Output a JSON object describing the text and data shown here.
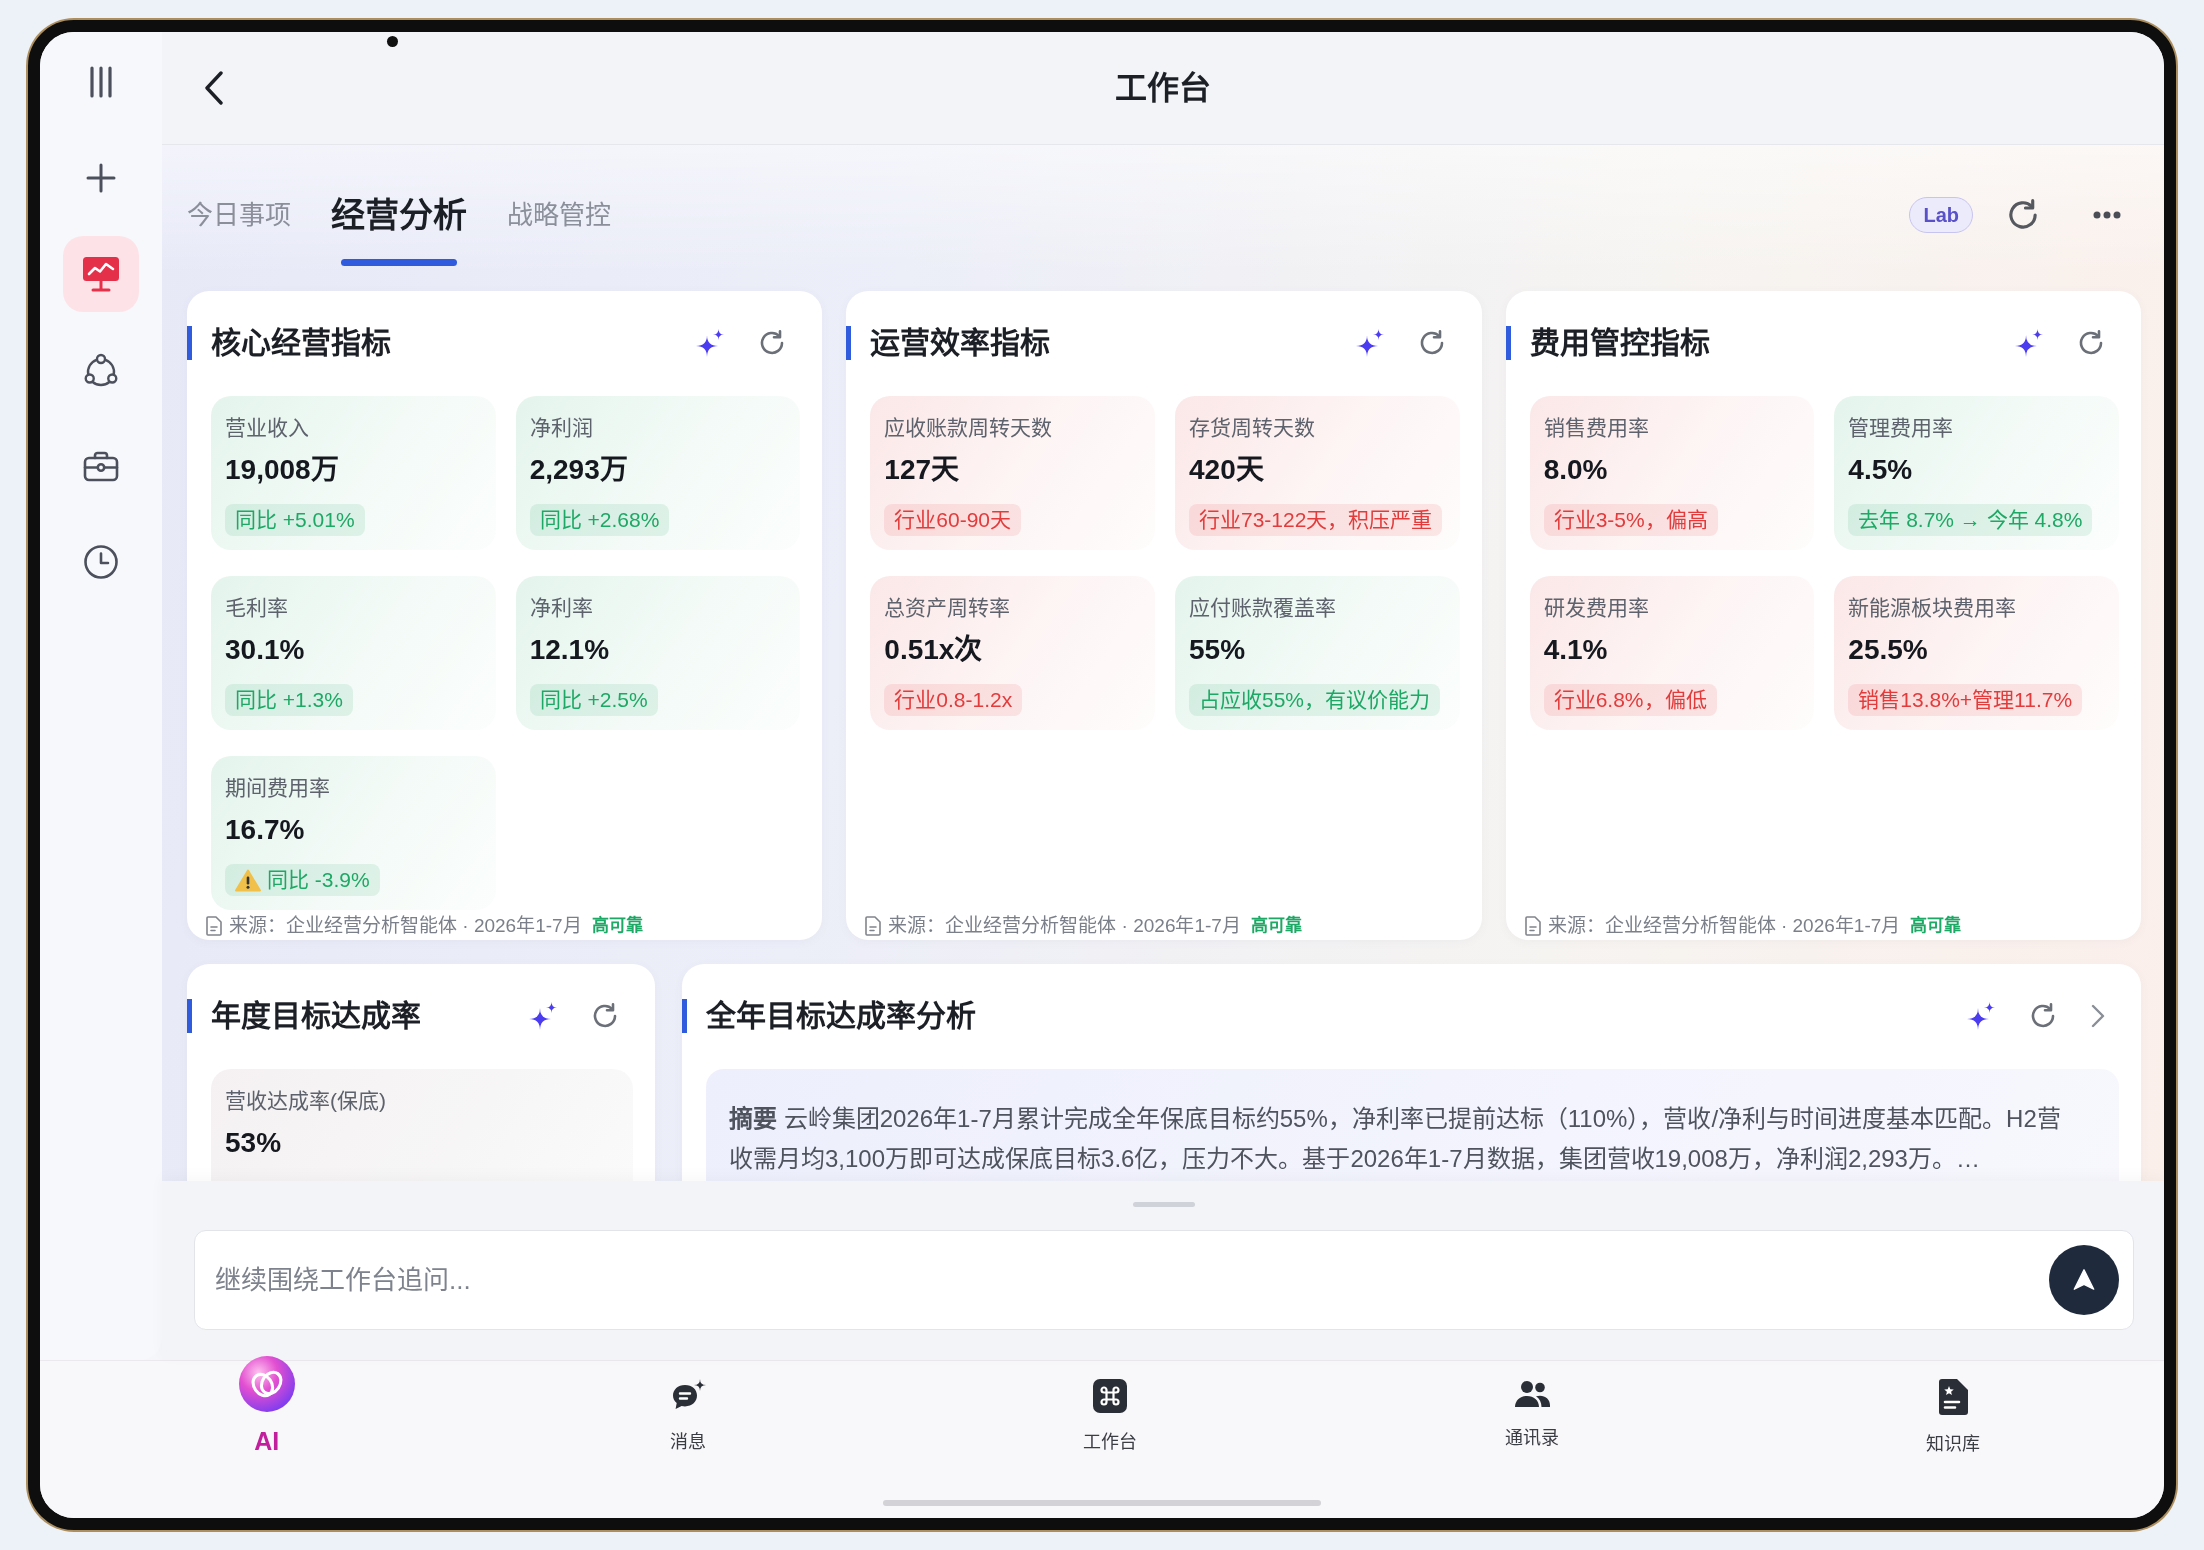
{
  "header": {
    "title": "工作台"
  },
  "sidebar": {
    "actions": [
      {
        "kind": "toggle"
      },
      {
        "kind": "add"
      }
    ],
    "items": [
      {
        "kind": "dashboard",
        "selected": true
      },
      {
        "kind": "network",
        "selected": false
      },
      {
        "kind": "toolkit",
        "selected": false
      },
      {
        "kind": "history",
        "selected": false
      }
    ]
  },
  "tabs": [
    {
      "label": "今日事项",
      "selected": false
    },
    {
      "label": "经营分析",
      "selected": true
    },
    {
      "label": "战略管控",
      "selected": false
    }
  ],
  "toolbar": {
    "badge": "Lab",
    "actions": [
      {
        "kind": "refresh"
      },
      {
        "kind": "more"
      }
    ]
  },
  "rows": [
    {
      "panels": [
        {
          "kind": "metrics",
          "title": "核心经营指标",
          "actions": [
            {
              "kind": "ai"
            },
            {
              "kind": "refresh"
            }
          ],
          "metrics": [
            {
              "label": "营业收入",
              "value": "19,008万",
              "note": "同比 +5.01%",
              "color": "#1ea865",
              "warning": false
            },
            {
              "label": "净利润",
              "value": "2,293万",
              "note": "同比 +2.68%",
              "color": "#1ea865",
              "warning": false
            },
            {
              "label": "毛利率",
              "value": "30.1%",
              "note": "同比 +1.3%",
              "color": "#1ea865",
              "warning": false
            },
            {
              "label": "净利率",
              "value": "12.1%",
              "note": "同比 +2.5%",
              "color": "#1ea865",
              "warning": false
            },
            {
              "label": "期间费用率",
              "value": "16.7%",
              "note": "同比 -3.9%",
              "color": "#1ea865",
              "warning": true
            }
          ],
          "source": "来源：企业经营分析智能体 · 2026年1-7月",
          "reliability": "高可靠"
        },
        {
          "kind": "metrics",
          "title": "运营效率指标",
          "actions": [
            {
              "kind": "ai"
            },
            {
              "kind": "refresh"
            }
          ],
          "metrics": [
            {
              "label": "应收账款周转天数",
              "value": "127天",
              "note": "行业60-90天",
              "color": "#e23b3b",
              "warning": false
            },
            {
              "label": "存货周转天数",
              "value": "420天",
              "note": "行业73-122天，积压严重",
              "color": "#e23b3b",
              "warning": false
            },
            {
              "label": "总资产周转率",
              "value": "0.51x次",
              "note": "行业0.8-1.2x",
              "color": "#e23b3b",
              "warning": false
            },
            {
              "label": "应付账款覆盖率",
              "value": "55%",
              "note": "占应收55%，有议价能力",
              "color": "#1ea865",
              "warning": false
            }
          ],
          "source": "来源：企业经营分析智能体 · 2026年1-7月",
          "reliability": "高可靠"
        },
        {
          "kind": "metrics",
          "title": "费用管控指标",
          "actions": [
            {
              "kind": "ai"
            },
            {
              "kind": "refresh"
            }
          ],
          "metrics": [
            {
              "label": "销售费用率",
              "value": "8.0%",
              "note": "行业3-5%，偏高",
              "color": "#e23b3b",
              "warning": false
            },
            {
              "label": "管理费用率",
              "value": "4.5%",
              "note": "去年 8.7% → 今年 4.8%",
              "color": "#1ea865",
              "warning": false
            },
            {
              "label": "研发费用率",
              "value": "4.1%",
              "note": "行业6.8%，偏低",
              "color": "#e23b3b",
              "warning": false
            },
            {
              "label": "新能源板块费用率",
              "value": "25.5%",
              "note": "销售13.8%+管理11.7%",
              "color": "#e23b3b",
              "warning": false
            }
          ],
          "source": "来源：企业经营分析智能体 · 2026年1-7月",
          "reliability": "高可靠"
        }
      ]
    },
    {
      "panels": [
        {
          "kind": "metrics",
          "title": "年度目标达成率",
          "actions": [
            {
              "kind": "ai"
            },
            {
              "kind": "refresh"
            }
          ],
          "metrics": [
            {
              "label": "营收达成率(保底)",
              "value": "53%"
            }
          ]
        },
        {
          "kind": "summary",
          "title": "全年目标达成率分析",
          "actions": [
            {
              "kind": "ai"
            },
            {
              "kind": "refresh"
            },
            {
              "kind": "open"
            }
          ],
          "summary": "**摘要** 云岭集团2026年1-7月累计完成全年保底目标约55%，净利率已提前达标（110%），营收/净利与时间进度基本匹配。H2营收需月均3,100万即可达成保底目标3.6亿，压力不大。基于2026年1-7月数据，集团营收19,008万，净利润2,293万。…"
        }
      ]
    }
  ],
  "composer": {
    "placeholder": "继续围绕工作台追问..."
  },
  "bottom_nav": [
    {
      "kind": "ai",
      "label": "AI",
      "selected": true
    },
    {
      "kind": "messages",
      "label": "消息",
      "selected": false
    },
    {
      "kind": "workbench",
      "label": "工作台",
      "selected": false
    },
    {
      "kind": "contacts",
      "label": "通讯录",
      "selected": false
    },
    {
      "kind": "knowledge",
      "label": "知识库",
      "selected": false
    }
  ]
}
